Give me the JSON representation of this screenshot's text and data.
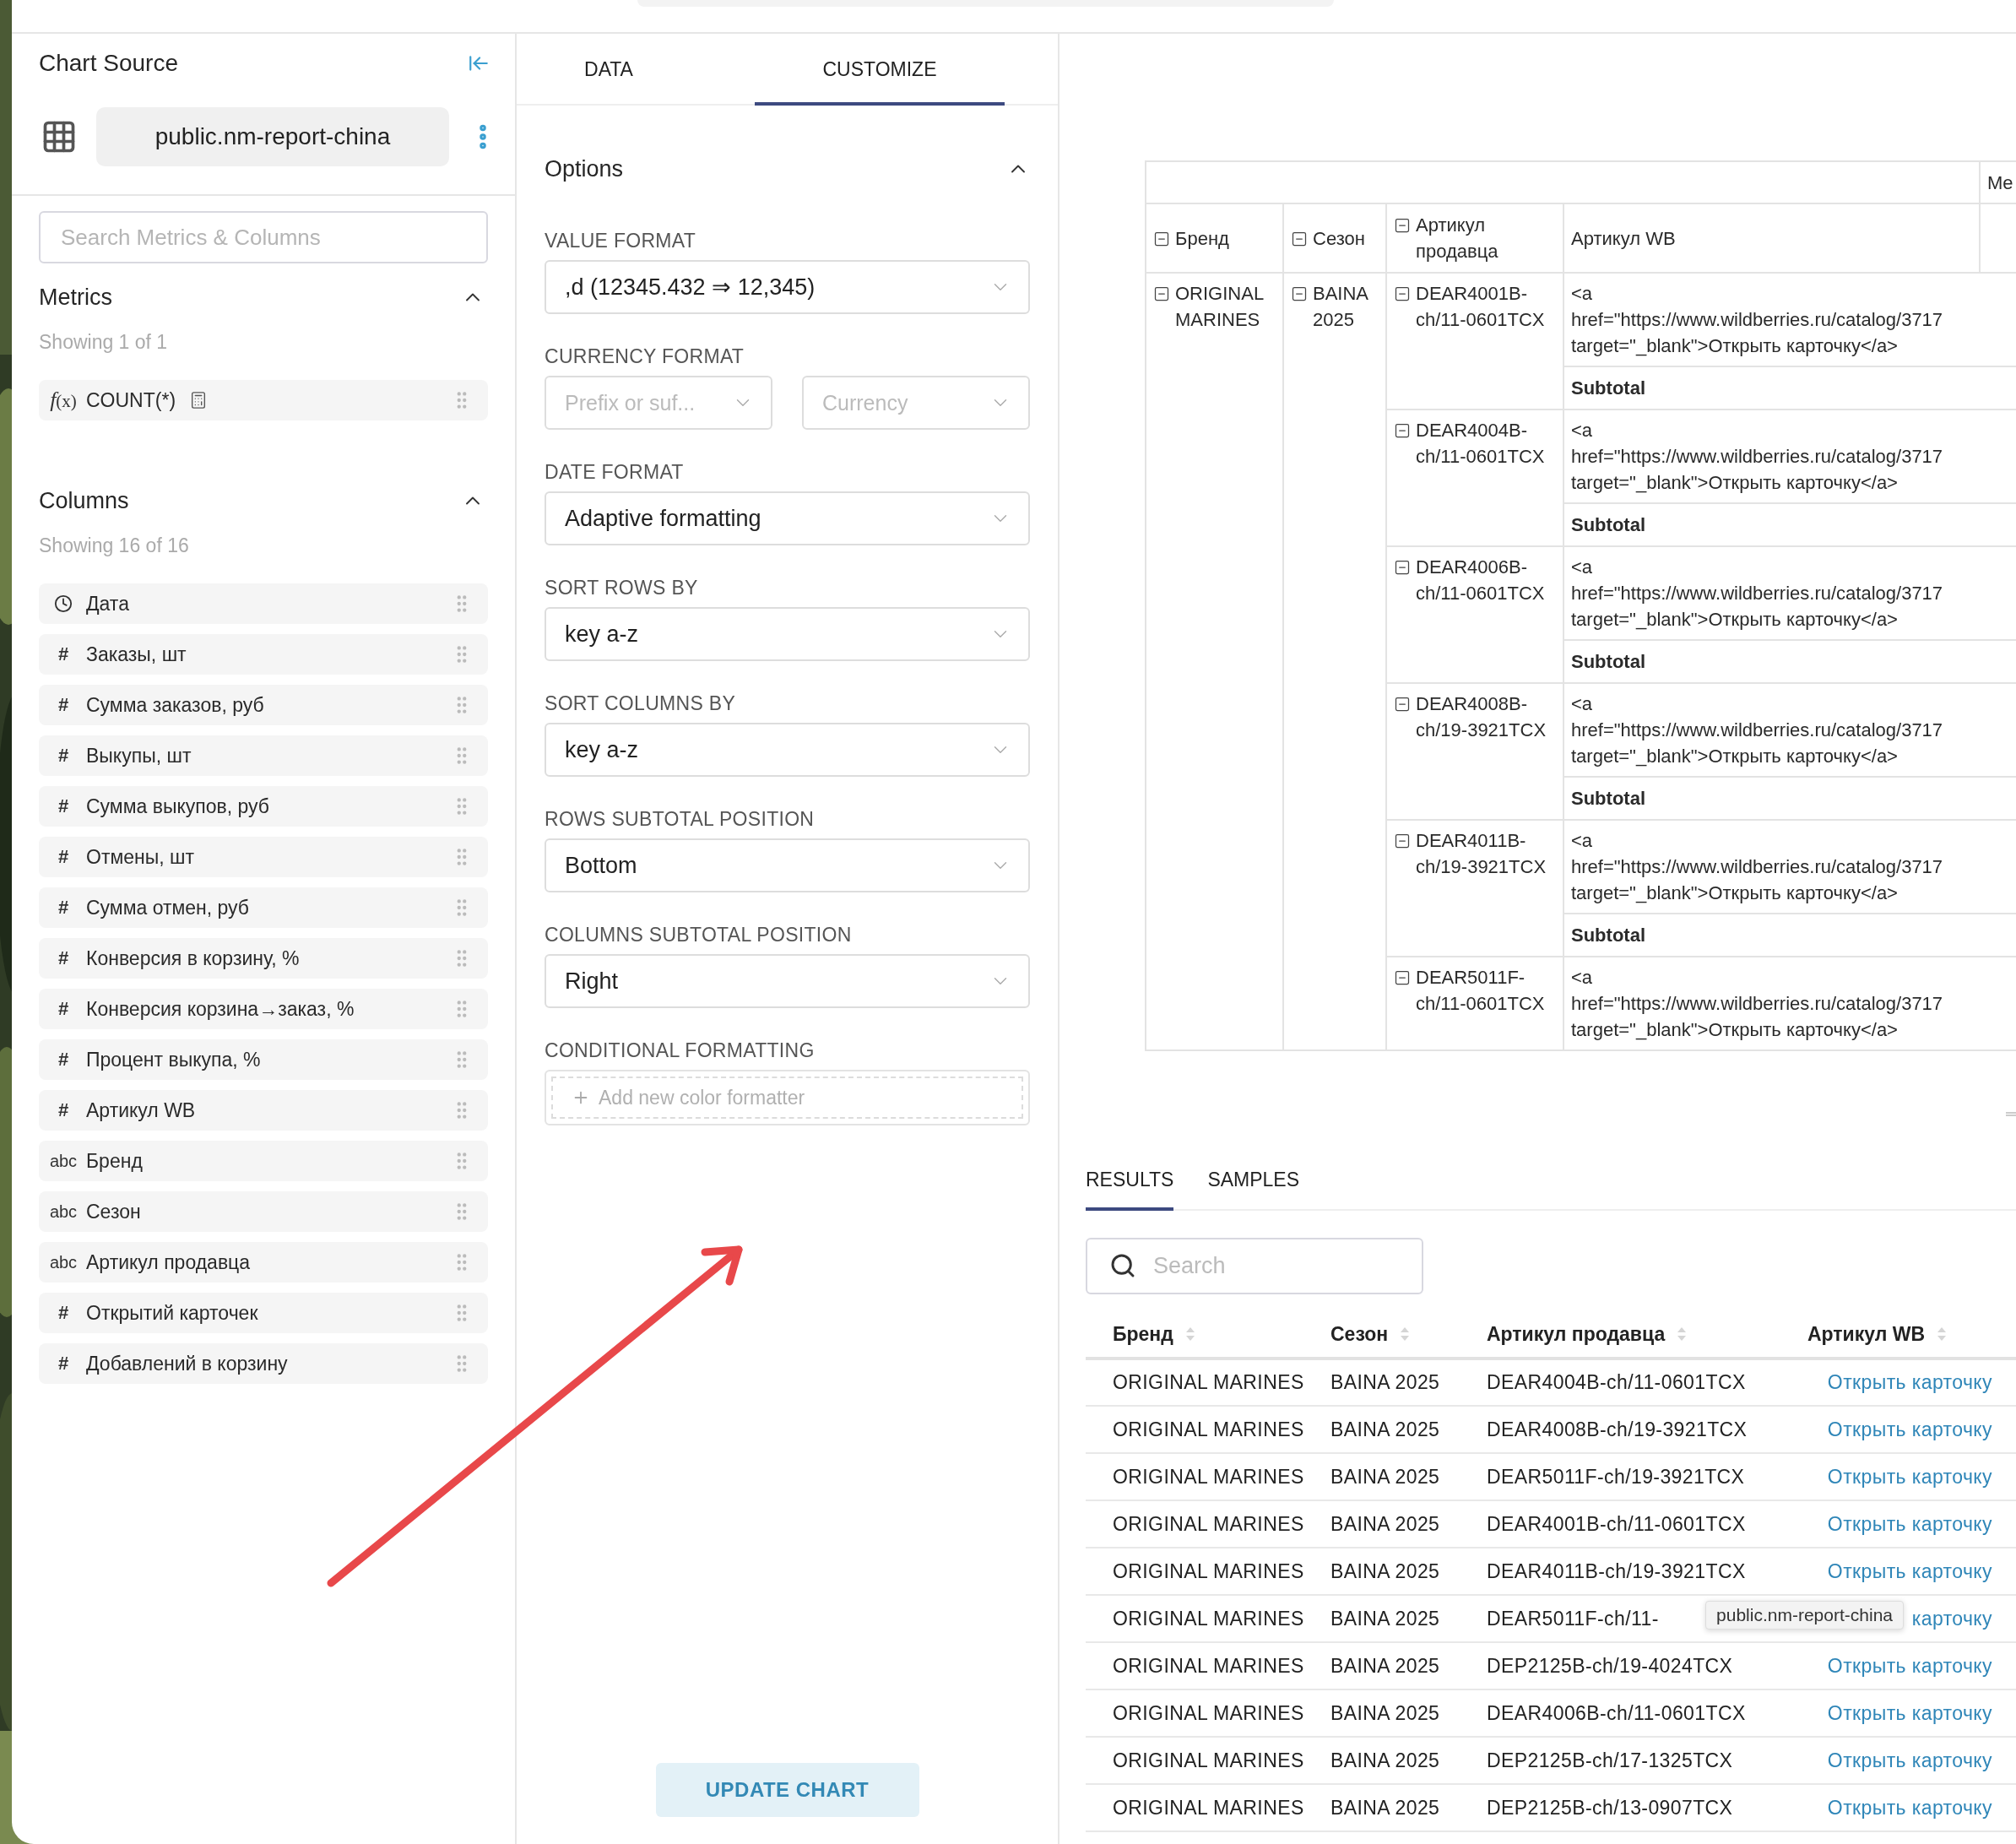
{
  "sidebar": {
    "title": "Chart Source",
    "dataset": "public.nm-report-china",
    "search": {
      "placeholder": "Search Metrics & Columns"
    },
    "sections": [
      {
        "title": "Metrics",
        "expanded": true,
        "count": "Showing 1 of 1",
        "items": [
          {
            "kind": "metric",
            "type_label": "*f*(x)",
            "label": "COUNT(*)"
          }
        ]
      },
      {
        "title": "Columns",
        "expanded": true,
        "count": "Showing 16 of 16",
        "items": [
          {
            "kind": "temporal",
            "label": "Дата"
          },
          {
            "kind": "numeric",
            "type_label": "#",
            "label": "Заказы, шт"
          },
          {
            "kind": "numeric",
            "type_label": "#",
            "label": "Сумма заказов, руб"
          },
          {
            "kind": "numeric",
            "type_label": "#",
            "label": "Выкупы, шт"
          },
          {
            "kind": "numeric",
            "type_label": "#",
            "label": "Сумма выкупов, руб"
          },
          {
            "kind": "numeric",
            "type_label": "#",
            "label": "Отмены, шт"
          },
          {
            "kind": "numeric",
            "type_label": "#",
            "label": "Сумма отмен, руб"
          },
          {
            "kind": "numeric",
            "type_label": "#",
            "label": "Конверсия в корзину, %"
          },
          {
            "kind": "numeric",
            "type_label": "#",
            "label": "Конверсия корзина→заказ, %"
          },
          {
            "kind": "numeric",
            "type_label": "#",
            "label": "Процент выкупа, %"
          },
          {
            "kind": "numeric",
            "type_label": "#",
            "label": "Артикул WB"
          },
          {
            "kind": "string",
            "type_label": "abc",
            "label": "Бренд"
          },
          {
            "kind": "string",
            "type_label": "abc",
            "label": "Сезон"
          },
          {
            "kind": "string",
            "type_label": "abc",
            "label": "Артикул продавца"
          },
          {
            "kind": "numeric",
            "type_label": "#",
            "label": "Открытий карточек"
          },
          {
            "kind": "numeric",
            "type_label": "#",
            "label": "Добавлений в корзину"
          }
        ]
      }
    ]
  },
  "customize": {
    "tabs": [
      {
        "label": "DATA",
        "selected": false
      },
      {
        "label": "CUSTOMIZE",
        "selected": true
      }
    ],
    "options": {
      "title": "Options",
      "expanded": true,
      "fields": [
        {
          "kind": "select",
          "label": "VALUE FORMAT",
          "value": ",d (12345.432 ⇒ 12,345)"
        },
        {
          "kind": "select_pair",
          "label": "CURRENCY FORMAT",
          "selects": [
            {
              "placeholder": "Prefix or suf..."
            },
            {
              "placeholder": "Currency"
            }
          ]
        },
        {
          "kind": "select",
          "label": "DATE FORMAT",
          "value": "Adaptive formatting"
        },
        {
          "kind": "select",
          "label": "SORT ROWS BY",
          "value": "key a-z"
        },
        {
          "kind": "select",
          "label": "SORT COLUMNS BY",
          "value": "key a-z"
        },
        {
          "kind": "select",
          "label": "ROWS SUBTOTAL POSITION",
          "value": "Bottom"
        },
        {
          "kind": "select",
          "label": "COLUMNS SUBTOTAL POSITION",
          "value": "Right"
        },
        {
          "kind": "add",
          "label": "CONDITIONAL FORMATTING",
          "button": "Add new color formatter"
        }
      ]
    },
    "update_button": "UPDATE CHART"
  },
  "pivot": {
    "metric_header": "Me",
    "columns": [
      {
        "kind": "group",
        "expanded": true,
        "label": "Бренд"
      },
      {
        "kind": "group",
        "expanded": true,
        "label": "Сезон"
      },
      {
        "kind": "group",
        "expanded": true,
        "label": "Артикул продавца"
      },
      {
        "kind": "value",
        "label": "Артикул WB"
      }
    ],
    "brand": {
      "text": "ORIGINAL MARINES",
      "expanded": true
    },
    "season": {
      "text": "BAINA 2025",
      "expanded": true
    },
    "groups": [
      {
        "article": "DEAR4001B-ch/11-0601TCX",
        "expanded": true,
        "value_lines": [
          "<a",
          "href=\"https://www.wildberries.ru/catalog/3717",
          "target=\"_blank\">Открыть карточку</a>"
        ],
        "subtotal": "Subtotal"
      },
      {
        "article": "DEAR4004B-ch/11-0601TCX",
        "expanded": true,
        "value_lines": [
          "<a",
          "href=\"https://www.wildberries.ru/catalog/3717",
          "target=\"_blank\">Открыть карточку</a>"
        ],
        "subtotal": "Subtotal"
      },
      {
        "article": "DEAR4006B-ch/11-0601TCX",
        "expanded": true,
        "value_lines": [
          "<a",
          "href=\"https://www.wildberries.ru/catalog/3717",
          "target=\"_blank\">Открыть карточку</a>"
        ],
        "subtotal": "Subtotal"
      },
      {
        "article": "DEAR4008B-ch/19-3921TCX",
        "expanded": true,
        "value_lines": [
          "<a",
          "href=\"https://www.wildberries.ru/catalog/3717",
          "target=\"_blank\">Открыть карточку</a>"
        ],
        "subtotal": "Subtotal"
      },
      {
        "article": "DEAR4011B-ch/19-3921TCX",
        "expanded": true,
        "value_lines": [
          "<a",
          "href=\"https://www.wildberries.ru/catalog/3717",
          "target=\"_blank\">Открыть карточку</a>"
        ],
        "subtotal": "Subtotal"
      },
      {
        "article": "DEAR5011F-ch/11-0601TCX",
        "expanded": true,
        "value_lines": [
          "<a",
          "href=\"https://www.wildberries.ru/catalog/3717",
          "target=\"_blank\">Открыть карточку</a>"
        ]
      }
    ]
  },
  "results": {
    "tabs": [
      {
        "label": "RESULTS",
        "selected": true
      },
      {
        "label": "SAMPLES",
        "selected": false
      }
    ],
    "search": {
      "placeholder": "Search"
    },
    "columns": [
      "Бренд",
      "Сезон",
      "Артикул продавца",
      "Артикул WB"
    ],
    "rows": [
      {
        "cells": [
          "ORIGINAL MARINES",
          "BAINA 2025",
          "DEAR4004B-ch/11-0601TCX"
        ],
        "link": "Открыть карточку"
      },
      {
        "cells": [
          "ORIGINAL MARINES",
          "BAINA 2025",
          "DEAR4008B-ch/19-3921TCX"
        ],
        "link": "Открыть карточку"
      },
      {
        "cells": [
          "ORIGINAL MARINES",
          "BAINA 2025",
          "DEAR5011F-ch/19-3921TCX"
        ],
        "link": "Открыть карточку"
      },
      {
        "cells": [
          "ORIGINAL MARINES",
          "BAINA 2025",
          "DEAR4001B-ch/11-0601TCX"
        ],
        "link": "Открыть карточку"
      },
      {
        "cells": [
          "ORIGINAL MARINES",
          "BAINA 2025",
          "DEAR4011B-ch/19-3921TCX"
        ],
        "link": "Открыть карточку"
      },
      {
        "cells": [
          "ORIGINAL MARINES",
          "BAINA 2025",
          "DEAR5011F-ch/11-"
        ],
        "link": "карточку",
        "tooltip": "public.nm-report-china"
      },
      {
        "cells": [
          "ORIGINAL MARINES",
          "BAINA 2025",
          "DEP2125B-ch/19-4024TCX"
        ],
        "link": "Открыть карточку"
      },
      {
        "cells": [
          "ORIGINAL MARINES",
          "BAINA 2025",
          "DEAR4006B-ch/11-0601TCX"
        ],
        "link": "Открыть карточку"
      },
      {
        "cells": [
          "ORIGINAL MARINES",
          "BAINA 2025",
          "DEP2125B-ch/17-1325TCX"
        ],
        "link": "Открыть карточку"
      },
      {
        "cells": [
          "ORIGINAL MARINES",
          "BAINA 2025",
          "DEP2125B-ch/13-0907TCX"
        ],
        "link": "Открыть карточку"
      }
    ]
  }
}
